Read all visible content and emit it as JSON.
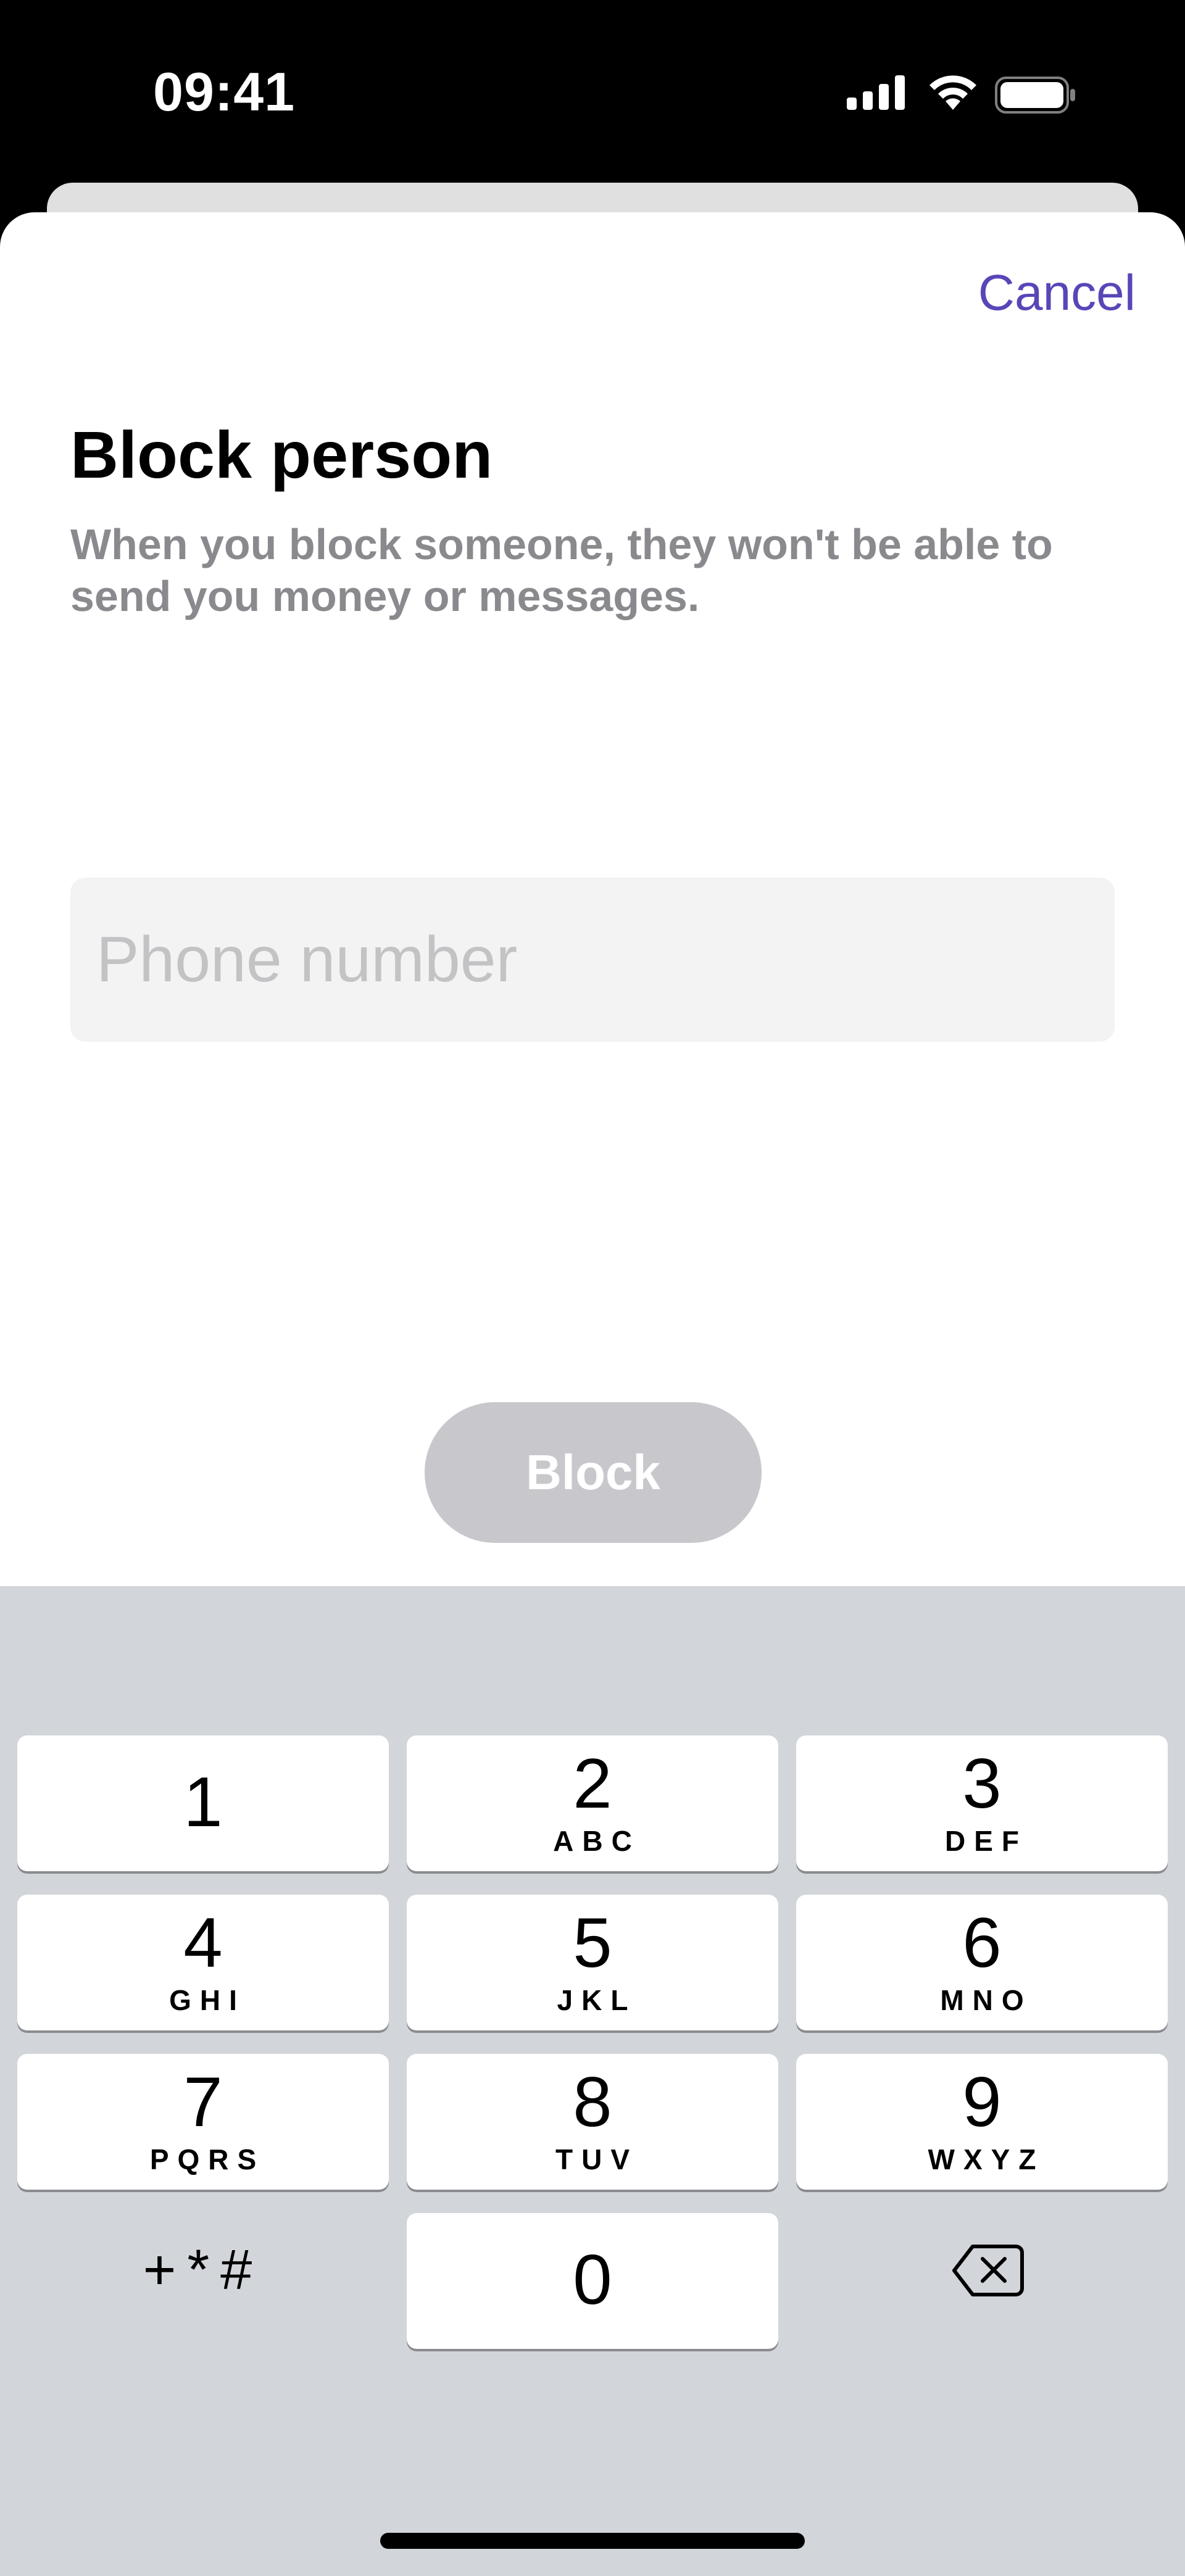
{
  "status_bar": {
    "time": "09:41",
    "icons": [
      "cellular-signal-icon",
      "wifi-icon",
      "battery-icon"
    ]
  },
  "sheet": {
    "cancel_label": "Cancel",
    "title": "Block person",
    "description": "When you block someone, they won't be able to send you money or messages.",
    "phone_input": {
      "value": "",
      "placeholder": "Phone number"
    },
    "block_label": "Block"
  },
  "keypad": {
    "keys": [
      {
        "digit": "1",
        "letters": ""
      },
      {
        "digit": "2",
        "letters": "ABC"
      },
      {
        "digit": "3",
        "letters": "DEF"
      },
      {
        "digit": "4",
        "letters": "GHI"
      },
      {
        "digit": "5",
        "letters": "JKL"
      },
      {
        "digit": "6",
        "letters": "MNO"
      },
      {
        "digit": "7",
        "letters": "PQRS"
      },
      {
        "digit": "8",
        "letters": "TUV"
      },
      {
        "digit": "9",
        "letters": "WXYZ"
      },
      {
        "digit": "0",
        "letters": ""
      }
    ],
    "symbols_label": "+*#",
    "delete_icon": "delete-backspace-icon"
  },
  "colors": {
    "accent": "#5a45b8",
    "disabled_button": "#c8c8cc",
    "keypad_background": "#d2d5da"
  }
}
